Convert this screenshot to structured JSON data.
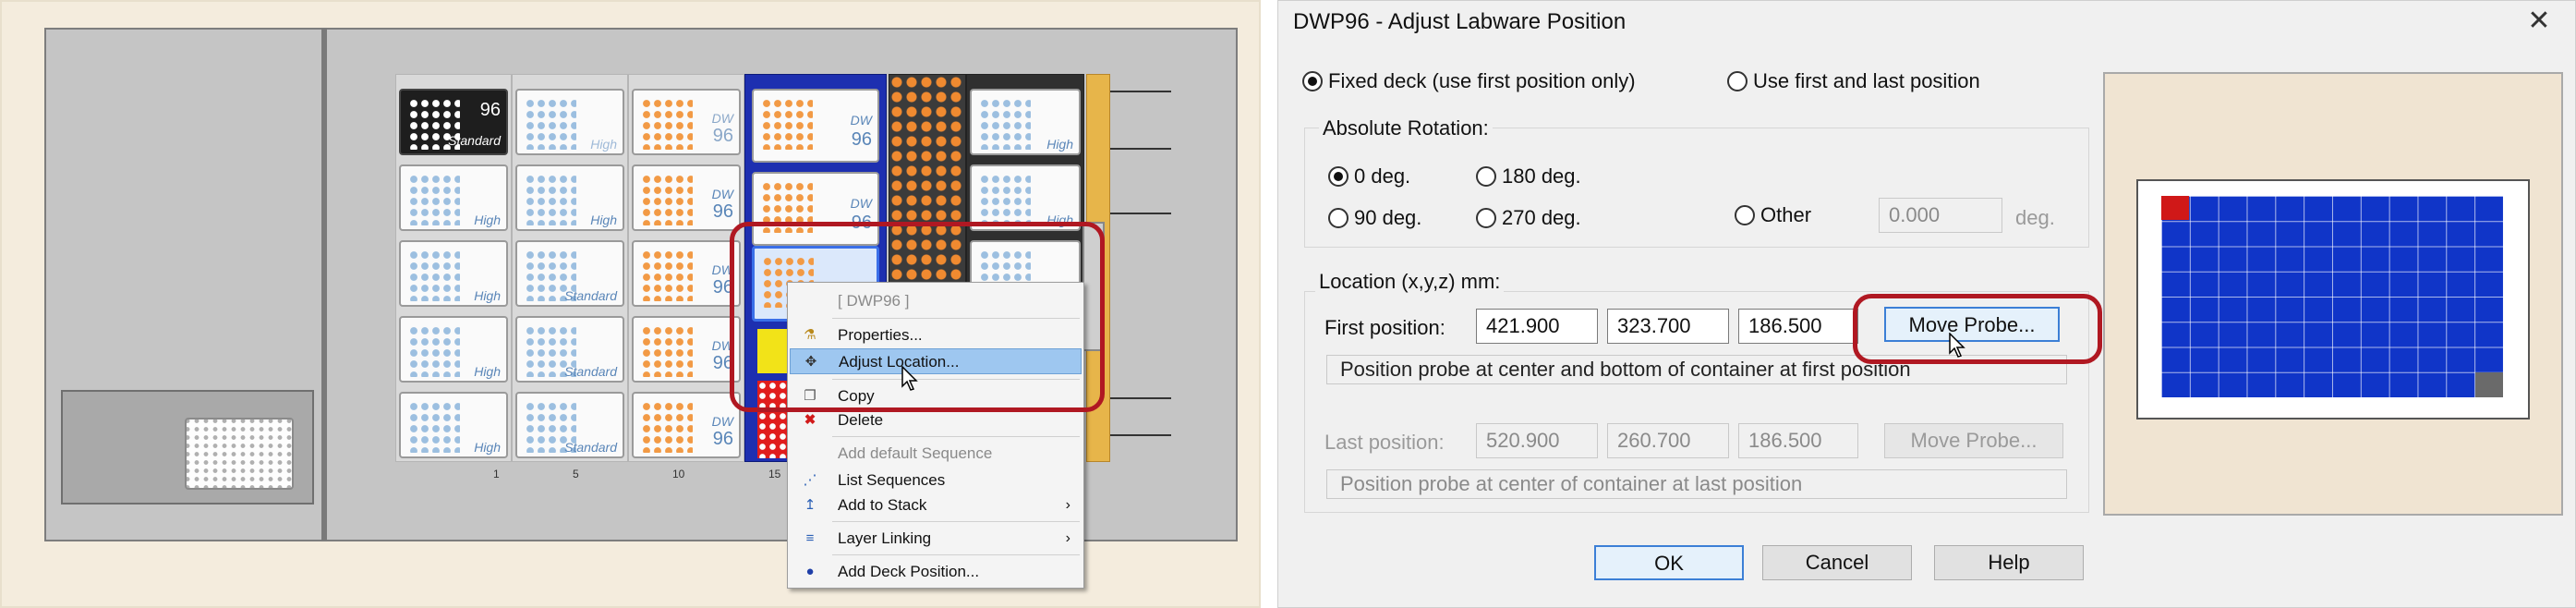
{
  "left": {
    "plates": {
      "standard": "Standard",
      "high": "High",
      "dw": "DW",
      "ninety_six": "96"
    },
    "column_labels": [
      "1",
      "5",
      "10",
      "15"
    ],
    "context_menu": {
      "header": "[ DWP96 ]",
      "items": [
        {
          "label": "Properties...",
          "icon": "flask-icon",
          "enabled": true
        },
        {
          "label": "Adjust Location...",
          "icon": "move-arrows-icon",
          "enabled": true,
          "highlighted": true
        },
        {
          "label": "Copy",
          "icon": "copy-icon",
          "enabled": true
        },
        {
          "label": "Delete",
          "icon": "delete-x-icon",
          "enabled": true
        },
        {
          "label": "Add default Sequence",
          "icon": "",
          "enabled": false
        },
        {
          "label": "List Sequences",
          "icon": "sequence-icon",
          "enabled": true
        },
        {
          "label": "Add to Stack",
          "icon": "stack-icon",
          "enabled": true,
          "submenu": true
        },
        {
          "label": "Layer Linking",
          "icon": "layer-link-icon",
          "enabled": true,
          "submenu": true
        },
        {
          "label": "Add Deck Position...",
          "icon": "dot-icon",
          "enabled": true
        }
      ]
    }
  },
  "dialog": {
    "title": "DWP96 - Adjust Labware Position",
    "mode": {
      "fixed_label": "Fixed deck (use first position only)",
      "first_last_label": "Use first and last position",
      "selected": "fixed"
    },
    "rotation": {
      "group_label": "Absolute Rotation:",
      "options": [
        "0 deg.",
        "180 deg.",
        "90 deg.",
        "270 deg."
      ],
      "selected": "0 deg.",
      "other_label": "Other",
      "other_value": "0.000",
      "other_unit": "deg."
    },
    "location": {
      "group_label": "Location (x,y,z) mm:",
      "first_label": "First position:",
      "first_values": [
        "421.900",
        "323.700",
        "186.500"
      ],
      "first_button": "Move Probe...",
      "first_info": "Position probe at center and bottom of container at first position",
      "last_label": "Last position:",
      "last_values": [
        "520.900",
        "260.700",
        "186.500"
      ],
      "last_button": "Move Probe...",
      "last_info": "Position probe at center of container at last position"
    },
    "buttons": {
      "ok": "OK",
      "cancel": "Cancel",
      "help": "Help"
    },
    "colors": {
      "well": "#1035c8",
      "first_well": "#d01818",
      "last_well": "#6a6a6a",
      "highlight": "#b01822"
    }
  }
}
